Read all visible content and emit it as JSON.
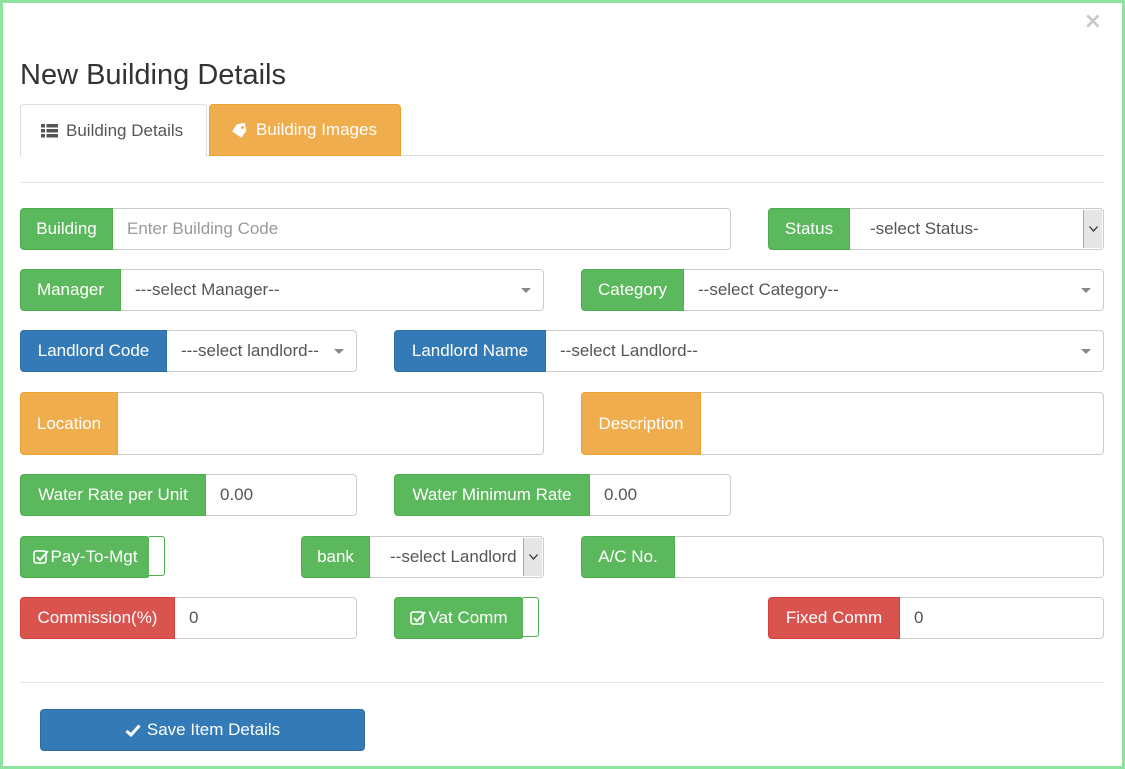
{
  "modal": {
    "close_symbol": "×",
    "title": "New Building Details"
  },
  "tabs": [
    {
      "label": "Building Details",
      "icon": "list-icon"
    },
    {
      "label": "Building Images",
      "icon": "tag-icon"
    }
  ],
  "form": {
    "building": {
      "label": "Building",
      "placeholder": "Enter Building Code"
    },
    "status": {
      "label": "Status",
      "value": "-select Status-"
    },
    "manager": {
      "label": "Manager",
      "value": "---select Manager--"
    },
    "category": {
      "label": "Category",
      "value": "--select Category--"
    },
    "landlord_code": {
      "label": "Landlord Code",
      "value": "---select landlord--"
    },
    "landlord_name": {
      "label": "Landlord Name",
      "value": "--select Landlord--"
    },
    "location": {
      "label": "Location",
      "value": ""
    },
    "description": {
      "label": "Description",
      "value": ""
    },
    "water_rate": {
      "label": "Water Rate per Unit",
      "value": "0.00"
    },
    "water_min": {
      "label": "Water Minimum Rate",
      "value": "0.00"
    },
    "pay_to_mgt": {
      "label": "Pay-To-Mgt",
      "checked": true
    },
    "bank": {
      "label": "bank",
      "value": "--select Landlord"
    },
    "ac_no": {
      "label": "A/C No.",
      "value": ""
    },
    "commission": {
      "label": "Commission(%)",
      "value": "0"
    },
    "vat_comm": {
      "label": "Vat Comm",
      "checked": true
    },
    "fixed_comm": {
      "label": "Fixed Comm",
      "value": "0"
    }
  },
  "save_button": {
    "label": "Save Item Details",
    "icon": "check-icon"
  },
  "colors": {
    "green": "#5cb85c",
    "blue": "#337ab7",
    "orange": "#f0ad4e",
    "red": "#d9534f",
    "modal_border": "#8ee39f"
  }
}
